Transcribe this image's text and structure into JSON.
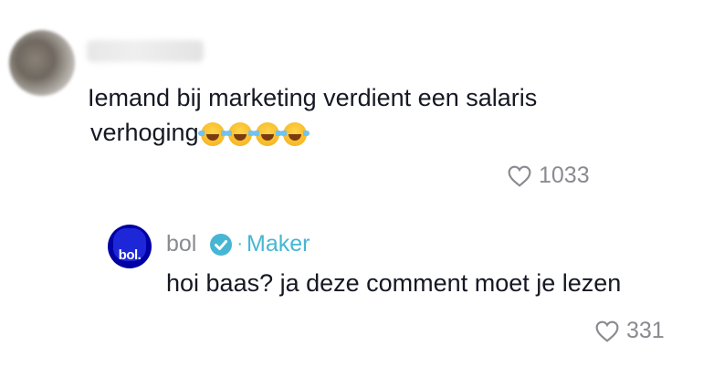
{
  "comment": {
    "avatar": "blurred-avatar",
    "username": "blurred",
    "text_line1": "Iemand bij marketing verdient een salaris",
    "text_line2": "verhoging",
    "emojis": [
      "face-with-tears-of-joy",
      "face-with-tears-of-joy",
      "face-with-tears-of-joy",
      "face-with-tears-of-joy"
    ],
    "likes": "1033"
  },
  "reply": {
    "avatar_text": "bol.",
    "username": "bol",
    "badge_separator": "·",
    "badge_label": "Maker",
    "text": "hoi baas? ja deze comment moet je lezen",
    "likes": "331"
  },
  "colors": {
    "text": "#161823",
    "muted": "#8a8b91",
    "accent": "#48b6d3",
    "bol_blue": "#0000a4"
  },
  "icons": [
    "heart-outline-icon",
    "verified-badge-icon"
  ]
}
